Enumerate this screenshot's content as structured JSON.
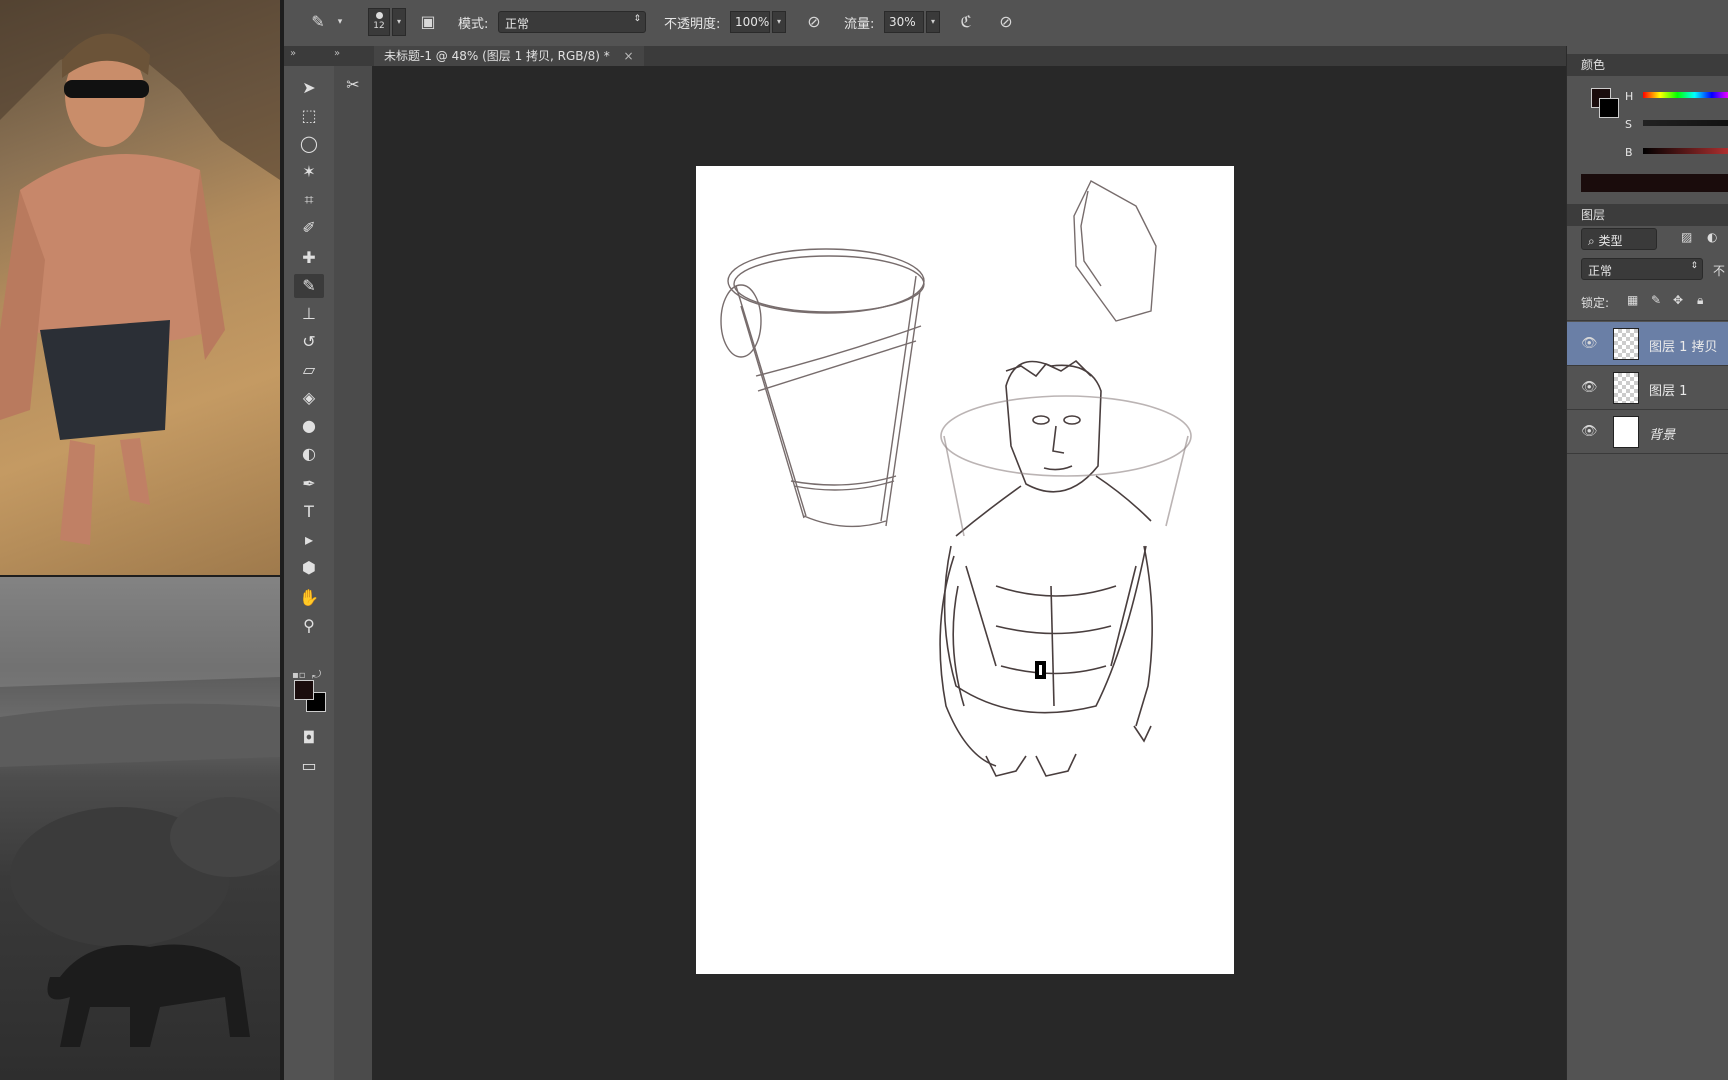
{
  "options_bar": {
    "brush_size": "12",
    "mode_label": "模式:",
    "mode_value": "正常",
    "opacity_label": "不透明度:",
    "opacity_value": "100%",
    "flow_label": "流量:",
    "flow_value": "30%"
  },
  "document_tab": {
    "title": "未标题-1 @ 48% (图层 1 拷贝, RGB/8) *",
    "close": "×"
  },
  "color_panel": {
    "title": "颜色",
    "h_label": "H",
    "s_label": "S",
    "b_label": "B",
    "foreground_color": "#1a0c0c",
    "background_color": "#000000"
  },
  "layers_panel": {
    "title": "图层",
    "filter_label": "类型",
    "blend_mode": "正常",
    "opacity_label_fragment": "不",
    "lock_label": "锁定:",
    "layers": [
      {
        "name": "图层 1 拷贝",
        "selected": true,
        "thumb": "checker"
      },
      {
        "name": "图层 1",
        "selected": false,
        "thumb": "checker"
      },
      {
        "name": "背景",
        "selected": false,
        "thumb": "white"
      }
    ]
  },
  "colors": {
    "ui_panel": "#535353",
    "workspace": "#282828",
    "selection": "#6a7fa6"
  }
}
